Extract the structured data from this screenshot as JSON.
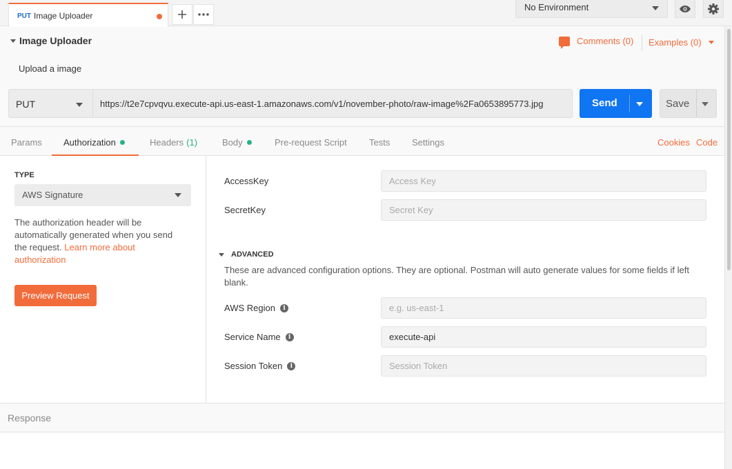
{
  "request_tab": {
    "method": "PUT",
    "name": "Image Uploader"
  },
  "environment": {
    "selected": "No Environment"
  },
  "request": {
    "title": "Image Uploader",
    "description": "Upload a image",
    "comments": "Comments (0)",
    "examples": "Examples (0)",
    "method": "PUT",
    "url": "https://t2e7cpvqvu.execute-api.us-east-1.amazonaws.com/v1/november-photo/raw-image%2Fa0653895773.jpg",
    "send_label": "Send",
    "save_label": "Save"
  },
  "subtabs": {
    "params": "Params",
    "authorization": "Authorization",
    "headers": "Headers",
    "headers_count": "(1)",
    "body": "Body",
    "prerequest": "Pre-request Script",
    "tests": "Tests",
    "settings": "Settings",
    "cookies": "Cookies",
    "code": "Code"
  },
  "auth": {
    "type_label": "TYPE",
    "type_value": "AWS Signature",
    "description": "The authorization header will be automatically generated when you send the request.",
    "learn_more": "Learn more about authorization",
    "preview_button": "Preview Request",
    "fields": {
      "access_key_label": "AccessKey",
      "access_key_placeholder": "Access Key",
      "secret_key_label": "SecretKey",
      "secret_key_placeholder": "Secret Key"
    },
    "advanced": {
      "heading": "ADVANCED",
      "description": "These are advanced configuration options. They are optional. Postman will auto generate values for some fields if left blank.",
      "region_label": "AWS Region",
      "region_placeholder": "e.g. us-east-1",
      "service_label": "Service Name",
      "service_value": "execute-api",
      "token_label": "Session Token",
      "token_placeholder": "Session Token"
    }
  },
  "response": {
    "label": "Response"
  },
  "colors": {
    "accent": "#f26b3a",
    "primary": "#1075f2",
    "success": "#26b47f"
  }
}
